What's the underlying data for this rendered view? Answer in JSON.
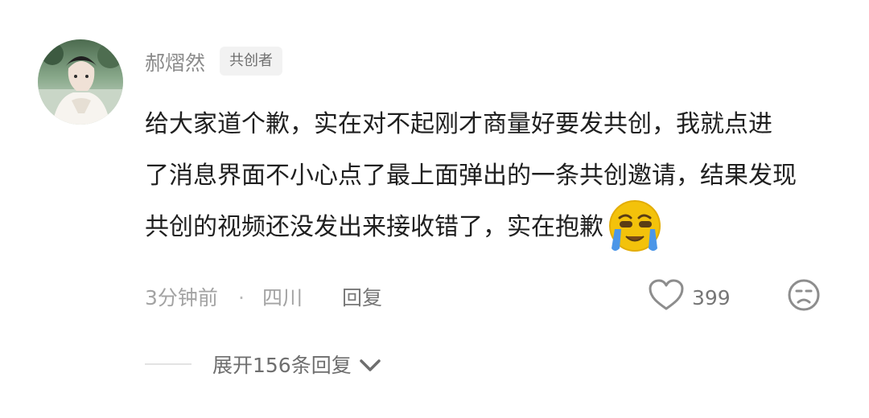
{
  "comment": {
    "author": {
      "name": "郝熠然",
      "badge": "共创者",
      "avatar": "avatar-photo"
    },
    "text_lines": [
      "给大家道个歉，实在对不起刚才商量好要发共创，我就点进",
      "了消息界面不小心点了最上面弹出的一条共创邀请，结果发现",
      "共创的视频还没发出来接收错了，实在抱歉"
    ],
    "emoji": "crying-laughing-emoji",
    "meta": {
      "time": "3分钟前",
      "separator": "·",
      "location": "四川",
      "reply_label": "回复"
    },
    "actions": {
      "like_icon": "heart-icon",
      "like_count": "399",
      "dislike_icon": "sad-face-icon"
    },
    "expand": {
      "label": "展开156条回复",
      "icon": "chevron-down-icon"
    }
  },
  "colors": {
    "text_primary": "#1f1f1f",
    "text_secondary": "#8a8a8a",
    "badge_background": "#f2f2f2",
    "divider": "#e3e3e3",
    "emoji_yellow": "#f3c20b",
    "emoji_tear": "#4b96e8"
  }
}
